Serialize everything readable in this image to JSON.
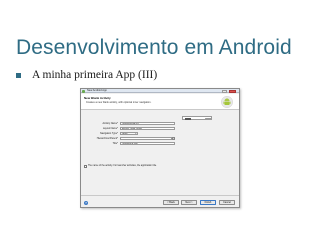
{
  "slide": {
    "title": "Desenvolvimento em Android",
    "bullet": "A minha primeira App (III)"
  },
  "dialog": {
    "window_title": "New Android App",
    "heading": "New Blank Activity",
    "description": "Creates a new blank activity, with optional inner navigation.",
    "fields": [
      {
        "label": "Activity Name*",
        "value": "HelloAndroid.bly"
      },
      {
        "label": "Layout Name*",
        "value": "activity_hello_world"
      },
      {
        "label": "Navigation Type*",
        "value": "None"
      },
      {
        "label": "Hierarchical Parent*",
        "value": ""
      },
      {
        "label": "Title*",
        "value": "HelloWorld App"
      }
    ],
    "checkbox_label": "The name of the activity. For launcher activities, the application title.",
    "buttons": {
      "help": "?",
      "back": "< Back",
      "next": "Next >",
      "finish": "Finish",
      "cancel": "Cancel"
    },
    "browse_label": "..."
  },
  "colors": {
    "title": "#2f6c84",
    "bullet": "#2f6c84",
    "android_green": "#a4c639"
  }
}
